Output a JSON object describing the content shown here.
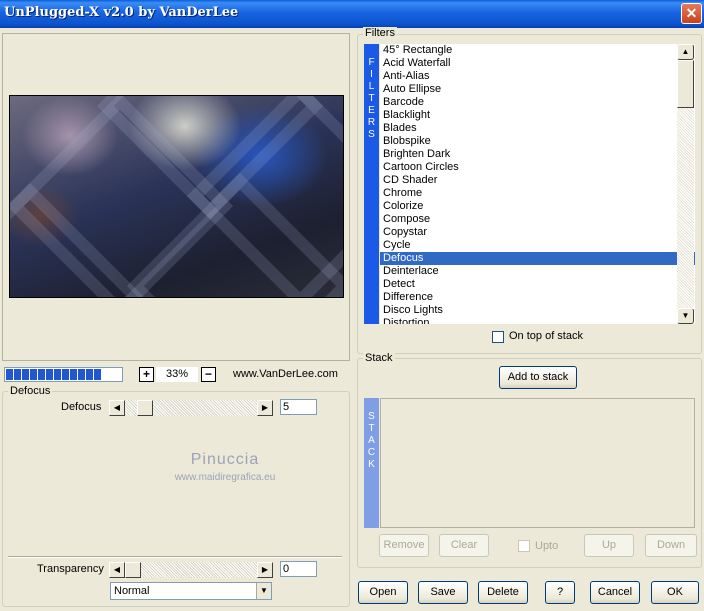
{
  "window": {
    "title": "UnPlugged-X v2.0 by VanDerLee",
    "close_glyph": "✕"
  },
  "zoom": {
    "value": "33%",
    "plus": "+",
    "minus": "−",
    "site": "www.VanDerLee.com",
    "progress_segments": 12
  },
  "parameters": {
    "group_label": "Defocus",
    "defocus_label": "Defocus",
    "defocus_value": "5",
    "transparency_label": "Transparency",
    "transparency_value": "0",
    "blend_mode": "Normal"
  },
  "watermark": {
    "line1": "Pinuccia",
    "line2": "www.maidiregrafica.eu"
  },
  "filters": {
    "group_label": "Filters",
    "vertical_label": [
      "F",
      "I",
      "L",
      "T",
      "E",
      "R",
      "S"
    ],
    "items": [
      "45° Rectangle",
      "Acid Waterfall",
      "Anti-Alias",
      "Auto Ellipse",
      "Barcode",
      "Blacklight",
      "Blades",
      "Blobspike",
      "Brighten Dark",
      "Cartoon Circles",
      "CD Shader",
      "Chrome",
      "Colorize",
      "Compose",
      "Copystar",
      "Cycle",
      "Defocus",
      "Deinterlace",
      "Detect",
      "Difference",
      "Disco Lights",
      "Distortion"
    ],
    "selected": "Defocus",
    "on_top_label": "On top of stack"
  },
  "stack": {
    "group_label": "Stack",
    "vertical_label": [
      "S",
      "T",
      "A",
      "C",
      "K"
    ],
    "add_button": "Add to stack",
    "remove_button": "Remove",
    "clear_button": "Clear",
    "upto_label": "Upto",
    "up_button": "Up",
    "down_button": "Down"
  },
  "footer": {
    "open": "Open",
    "save": "Save",
    "delete": "Delete",
    "help": "?",
    "cancel": "Cancel",
    "ok": "OK"
  },
  "colors": {
    "title_blue": "#0d54cf",
    "selection": "#316ac5",
    "filters_bar": "#1a5ae6",
    "stack_bar": "#7f9ee6"
  }
}
